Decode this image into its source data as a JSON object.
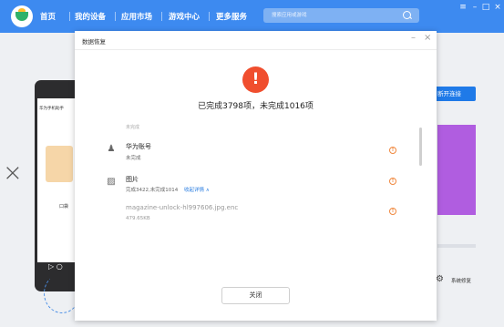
{
  "nav": {
    "items": [
      "首页",
      "我的设备",
      "应用市场",
      "游戏中心",
      "更多服务"
    ],
    "search_placeholder": "搜索应用或游戏"
  },
  "window_controls": [
    "≡",
    "–",
    "□",
    "×"
  ],
  "background": {
    "phone_title": "华为手机助手",
    "phone_text": "口袋",
    "disconnect_label": "断开连接",
    "repair_label": "系统修复",
    "close_mark": "×"
  },
  "dialog": {
    "title": "数据恢复",
    "controls": [
      "–",
      "×"
    ],
    "summary": "已完成3798项，未完成1016项",
    "clipped_text": "未完成",
    "items": [
      {
        "icon": "person-icon",
        "title": "华为账号",
        "sub": "未完成"
      },
      {
        "icon": "image-icon",
        "title": "图片",
        "sub": "完成3422,未完成1014",
        "link": "收起详情 ∧"
      }
    ],
    "file": {
      "name": "magazine-unlock-hl997606.jpg.enc",
      "size": "479.65KB"
    },
    "close_label": "关闭"
  },
  "colors": {
    "topbar": "#3d8af0",
    "warning": "#f04e2e",
    "accent_link": "#2a7de1"
  }
}
